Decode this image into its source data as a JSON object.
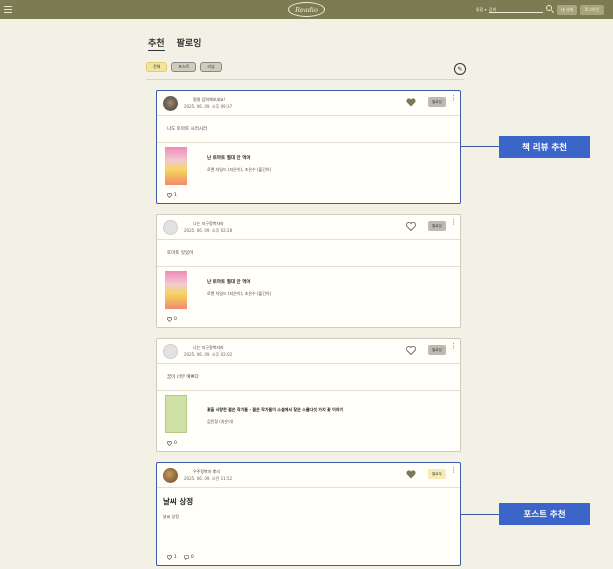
{
  "header": {
    "logo": "Readio",
    "search_type": "통합 ▾",
    "search_placeholder": "검색",
    "signup_label": "내 서재",
    "login_label": "로그아웃"
  },
  "tabs": [
    {
      "label": "추천",
      "active": true
    },
    {
      "label": "팔로잉",
      "active": false
    }
  ],
  "filters": [
    {
      "label": "전체",
      "active": true
    },
    {
      "label": "포스트",
      "active": false
    },
    {
      "label": "리뷰",
      "active": false
    }
  ],
  "cards": [
    {
      "username": "필명 입력해보세요!",
      "timestamp": "2025. 06. 09. 오후 09:37",
      "liked": true,
      "follow_label": "팔로잉",
      "text": "나도 토마토 시러시러",
      "book_title": "난 토마토 절대 안 먹어",
      "book_author": "로렌 차일드 (지은이), 조은수 (옮긴이)",
      "likes": "1"
    },
    {
      "username": "나는 지구정복자라",
      "timestamp": "2025. 06. 09. 오후 02:28",
      "liked": false,
      "follow_label": "팔로잉",
      "text": "토마토 맛있어",
      "book_title": "난 토마토 절대 안 먹어",
      "book_author": "로렌 차일드 (지은이), 조은수 (옮긴이)",
      "likes": "0"
    },
    {
      "username": "나는 지구정복자라",
      "timestamp": "2025. 06. 09. 오후 02:02",
      "liked": false,
      "follow_label": "팔로잉",
      "text": "꿈이 너무 예쁘다",
      "book_title": "꽃을 사랑한 젊은 작가들 - 젊은 작가들이 소설에서 찾은 스물다섯 가지 꽃 이야기",
      "book_author": "김민정 (지은이)",
      "likes": "0"
    },
    {
      "username": "우주정복자 뿌리",
      "timestamp": "2025. 06. 09. 오전 11:52",
      "liked": true,
      "follow_label": "팔로우",
      "post_title": "날씨 상정",
      "post_body": "날씨 상정",
      "likes": "1",
      "comments": "0"
    }
  ],
  "callouts": {
    "review": "책 리뷰 추천",
    "post": "포스트 추천"
  },
  "colors": {
    "topbar": "#7d7b52",
    "callout": "#3b65c8",
    "highlight_border": "#3e5aa8",
    "active_chip": "#f4e59c",
    "heart_filled": "#7a7850"
  }
}
